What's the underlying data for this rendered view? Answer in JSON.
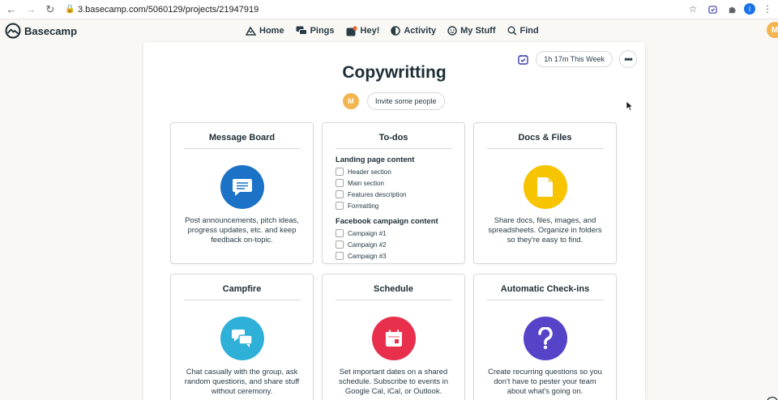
{
  "browser": {
    "url": "3.basecamp.com/5060129/projects/21947919",
    "profile_initial": "I"
  },
  "nav": {
    "brand": "Basecamp",
    "items": [
      {
        "label": "Home",
        "icon": "mountain-icon"
      },
      {
        "label": "Pings",
        "icon": "chat-bubbles-icon"
      },
      {
        "label": "Hey!",
        "icon": "bell-icon"
      },
      {
        "label": "Activity",
        "icon": "half-moon-icon"
      },
      {
        "label": "My Stuff",
        "icon": "smiley-icon"
      },
      {
        "label": "Find",
        "icon": "search-icon"
      }
    ],
    "avatar_initial": "M"
  },
  "project": {
    "title": "Copywritting",
    "time_label": "1h 17m This Week",
    "person_initial": "M",
    "invite_label": "Invite some people"
  },
  "cards": {
    "message_board": {
      "title": "Message Board",
      "desc": "Post announcements, pitch ideas, progress updates, etc. and keep feedback on-topic.",
      "color": "#1b72c6"
    },
    "todos": {
      "title": "To-dos",
      "groups": [
        {
          "title": "Landing page content",
          "items": [
            "Header section",
            "Main section",
            "Features description",
            "Formatting"
          ]
        },
        {
          "title": "Facebook campaign content",
          "items": [
            "Campaign #1",
            "Campaign #2",
            "Campaign #3"
          ]
        }
      ]
    },
    "docs": {
      "title": "Docs & Files",
      "desc": "Share docs, files, images, and spreadsheets. Organize in folders so they're easy to find.",
      "color": "#f7c400"
    },
    "campfire": {
      "title": "Campfire",
      "desc": "Chat casually with the group, ask random questions, and share stuff without ceremony.",
      "color": "#2fb0d8"
    },
    "schedule": {
      "title": "Schedule",
      "desc": "Set important dates on a shared schedule. Subscribe to events in Google Cal, iCal, or Outlook.",
      "color": "#e8304c"
    },
    "checkins": {
      "title": "Automatic Check-ins",
      "desc": "Create recurring questions so you don't have to pester your team about what's going on.",
      "color": "#5544c8"
    }
  }
}
